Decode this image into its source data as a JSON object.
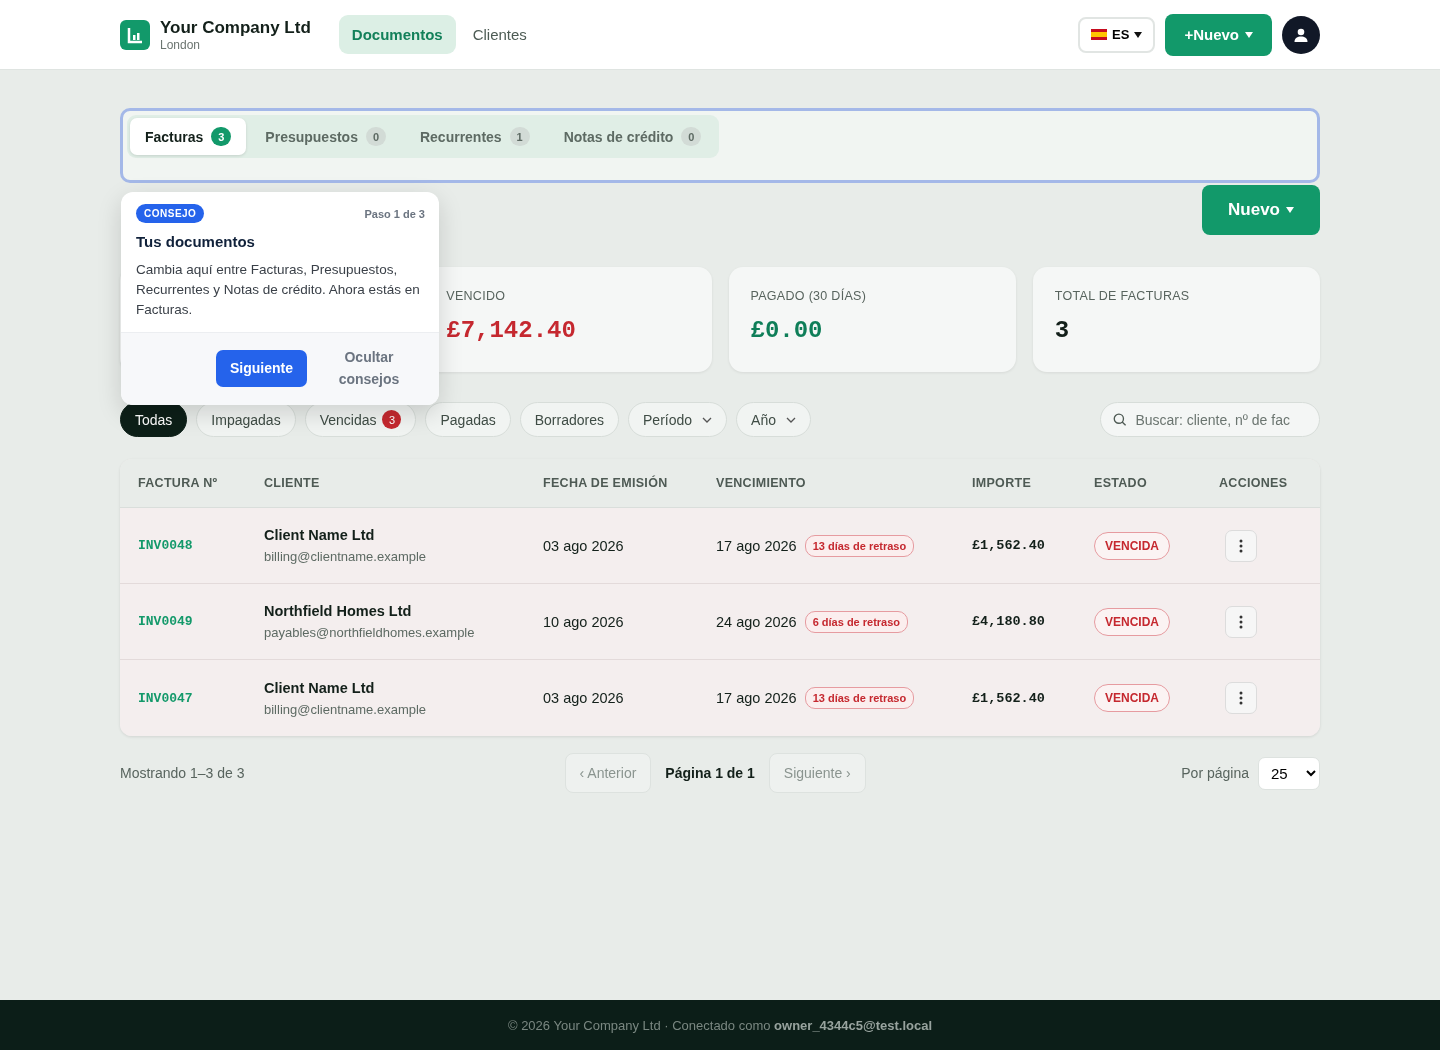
{
  "header": {
    "company": "Your Company Ltd",
    "location": "London",
    "nav": [
      {
        "label": "Documentos",
        "selected": true
      },
      {
        "label": "Clientes",
        "selected": false
      }
    ],
    "language": "ES",
    "new_button": "+Nuevo"
  },
  "doc_tabs": [
    {
      "label": "Facturas",
      "count": "3",
      "selected": true
    },
    {
      "label": "Presupuestos",
      "count": "0",
      "selected": false
    },
    {
      "label": "Recurrentes",
      "count": "1",
      "selected": false
    },
    {
      "label": "Notas de crédito",
      "count": "0",
      "selected": false
    }
  ],
  "new_button": "Nuevo",
  "tip": {
    "badge": "CONSEJO",
    "step": "Paso 1 de 3",
    "title": "Tus documentos",
    "body": "Cambia aquí entre Facturas, Presupuestos, Recurrentes y Notas de crédito. Ahora estás en Facturas.",
    "next": "Siguiente",
    "hide": "Ocultar consejos"
  },
  "stats": [
    {
      "label": "VENCIDO",
      "value": "£7,142.40",
      "color": "#c5282f"
    },
    {
      "label": "PAGADO (30 DÍAS)",
      "value": "£0.00",
      "color": "#0e7e58"
    },
    {
      "label": "TOTAL DE FACTURAS",
      "value": "3",
      "color": "#13201a"
    }
  ],
  "filters": [
    {
      "kind": "chip",
      "label": "Todas",
      "selected": true
    },
    {
      "kind": "chip",
      "label": "Impagadas",
      "selected": false
    },
    {
      "kind": "chip",
      "label": "Vencidas",
      "count": "3",
      "selected": false
    },
    {
      "kind": "chip",
      "label": "Pagadas",
      "selected": false
    },
    {
      "kind": "chip",
      "label": "Borradores",
      "selected": false
    },
    {
      "kind": "dropdown",
      "label": "Período",
      "selected": false
    },
    {
      "kind": "dropdown",
      "label": "Año",
      "selected": false
    }
  ],
  "search": {
    "placeholder": "Buscar: cliente, nº de fac"
  },
  "table": {
    "columns": [
      "FACTURA Nº",
      "CLIENTE",
      "FECHA DE EMISIÓN",
      "VENCIMIENTO",
      "IMPORTE",
      "ESTADO",
      "ACCIONES"
    ],
    "rows": [
      {
        "number": "INV0048",
        "client": "Client Name Ltd",
        "email": "billing@clientname.example",
        "issued": "03 ago 2026",
        "due": "17 ago 2026",
        "late": "13 días de retraso",
        "amount": "£1,562.40",
        "status": "VENCIDA",
        "overdue": true
      },
      {
        "number": "INV0049",
        "client": "Northfield Homes Ltd",
        "email": "payables@northfieldhomes.example",
        "issued": "10 ago 2026",
        "due": "24 ago 2026",
        "late": "6 días de retraso",
        "amount": "£4,180.80",
        "status": "VENCIDA",
        "overdue": true
      },
      {
        "number": "INV0047",
        "client": "Client Name Ltd",
        "email": "billing@clientname.example",
        "issued": "03 ago 2026",
        "due": "17 ago 2026",
        "late": "13 días de retraso",
        "amount": "£1,562.40",
        "status": "VENCIDA",
        "overdue": true
      }
    ]
  },
  "pagination": {
    "showing": "Mostrando 1–3 de 3",
    "prev": "‹ Anterior",
    "page": "Página 1 de 1",
    "next": "Siguiente ›",
    "per_page_label": "Por página",
    "per_page": "25"
  },
  "footer": {
    "text": "© 2026 Your Company Ltd · Conectado como",
    "user": "owner_4344c5@test.local"
  }
}
